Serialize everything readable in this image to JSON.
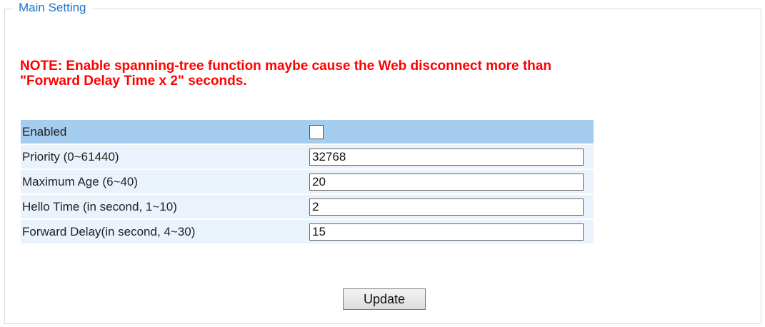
{
  "fieldset": {
    "legend": "Main Setting"
  },
  "note": {
    "line1": "NOTE: Enable spanning-tree function maybe cause the Web disconnect more than",
    "line2": "\"Forward Delay Time x 2\" seconds."
  },
  "settings": {
    "enabled_label": "Enabled",
    "enabled_checked": false,
    "rows": [
      {
        "label": "Priority (0~61440)",
        "value": "32768"
      },
      {
        "label": "Maximum Age (6~40)",
        "value": "20"
      },
      {
        "label": "Hello Time (in second, 1~10)",
        "value": "2"
      },
      {
        "label": "Forward Delay(in second, 4~30)",
        "value": "15"
      }
    ]
  },
  "actions": {
    "update_label": "Update"
  },
  "colors": {
    "legend": "#1a75c9",
    "note": "#ff0000",
    "header_row": "#a4cdf0",
    "data_row": "#eaf3fb"
  }
}
